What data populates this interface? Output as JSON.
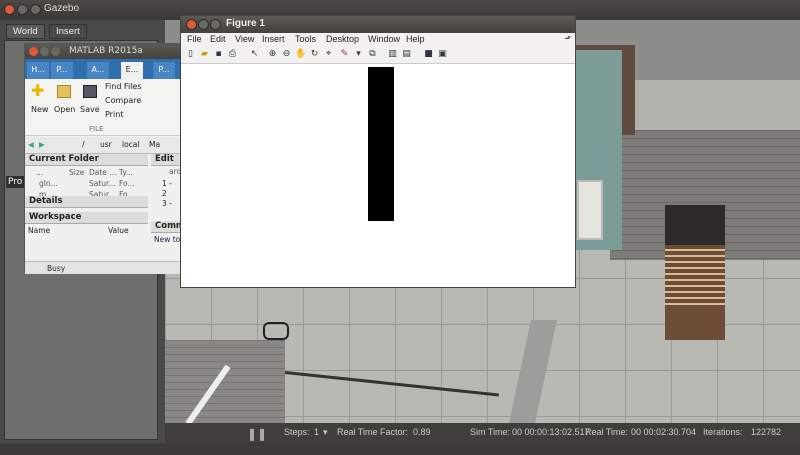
{
  "gazebo": {
    "title": "Gazebo",
    "tabs": [
      "World",
      "Insert"
    ],
    "side_label": "Pro",
    "status": {
      "steps_label": "Steps:",
      "steps_value": "1",
      "rtf_label": "Real Time Factor:",
      "rtf_value": "0.89",
      "sim_time_label": "Sim Time:",
      "sim_time_value": "00 00:00:13:02.517",
      "real_time_label": "Real Time:",
      "real_time_value": "00 00:02:30.704",
      "iterations_label": "Iterations:",
      "iterations_value": "122782"
    }
  },
  "matlab": {
    "title": "MATLAB R2015a",
    "tabs": [
      "H...",
      "P...",
      "A...",
      "E...",
      "P..."
    ],
    "ribbon": {
      "new": "New",
      "open": "Open",
      "save": "Save",
      "find_files": "Find Files",
      "compare": "Compare",
      "print": "Print",
      "section": "FILE"
    },
    "path_parts": [
      "/",
      "usr",
      "local",
      "Ma"
    ],
    "current_folder": {
      "title": "Current Folder",
      "cols": [
        "...",
        "Size",
        "Date ...",
        "Ty..."
      ],
      "rows": [
        {
          "name": "gln...",
          "date": "Satur...",
          "type": "Fo..."
        },
        {
          "name": "m...",
          "date": "Satur...",
          "type": "Fo..."
        }
      ],
      "details": "Details"
    },
    "workspace": {
      "title": "Workspace",
      "cols": [
        "Name",
        "Value"
      ]
    },
    "editor": {
      "title": "Edit",
      "file": "ard",
      "lines": [
        "1 -",
        "2",
        "3 -"
      ]
    },
    "command": {
      "title": "Comma",
      "hint": "New to"
    },
    "status": "Busy"
  },
  "figure": {
    "title": "Figure 1",
    "menu": [
      "File",
      "Edit",
      "View",
      "Insert",
      "Tools",
      "Desktop",
      "Window",
      "Help"
    ],
    "tools": [
      "new-icon",
      "open-icon",
      "save-icon",
      "print-icon",
      "pointer-icon",
      "zoom-in-icon",
      "zoom-out-icon",
      "pan-icon",
      "rotate-icon",
      "datacursor-icon",
      "brush-icon",
      "link-icon",
      "colorbar-icon",
      "legend-icon",
      "hide-tools-icon",
      "dock-icon"
    ]
  }
}
